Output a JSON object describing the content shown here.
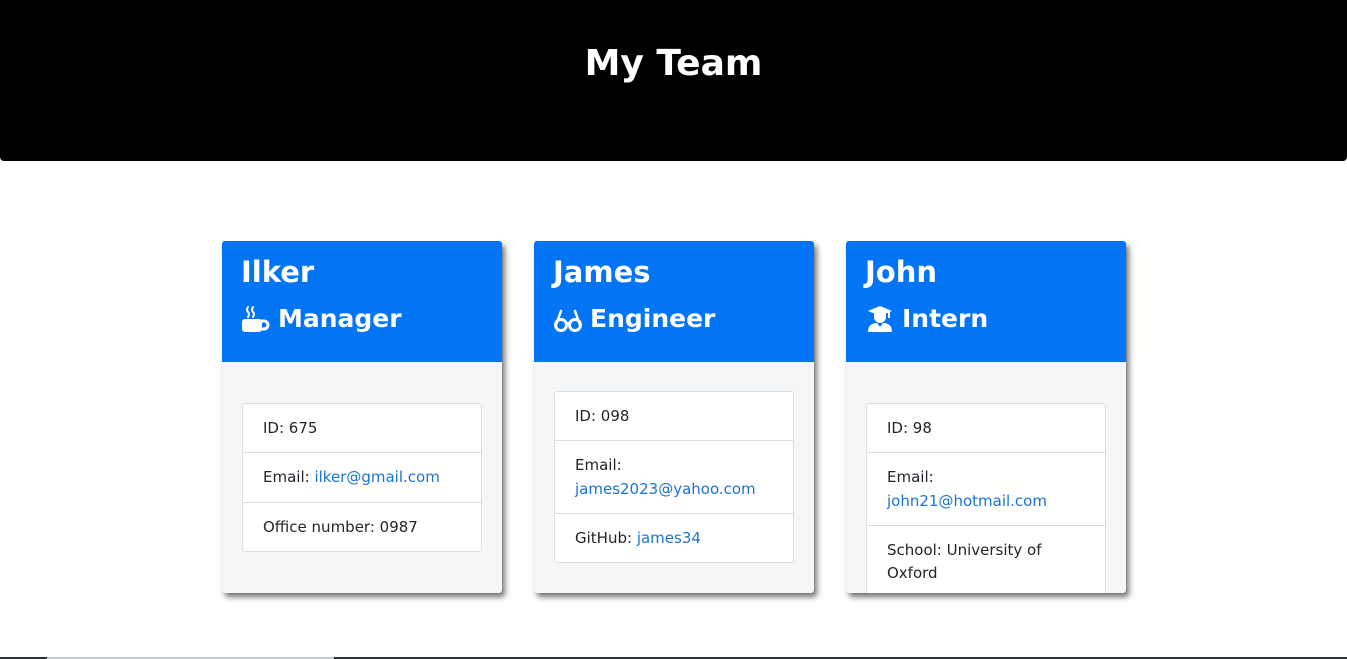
{
  "header": {
    "title": "My Team"
  },
  "team": [
    {
      "name": "Ilker",
      "role": "Manager",
      "icon": "coffee-mug-icon",
      "id_label": "ID: ",
      "id": "675",
      "email_label": "Email: ",
      "email": "ilker@gmail.com",
      "extra_label": "Office number: ",
      "extra": "0987"
    },
    {
      "name": "James",
      "role": "Engineer",
      "icon": "glasses-icon",
      "id_label": "ID: ",
      "id": "098",
      "email_label": "Email: ",
      "email": "james2023@yahoo.com",
      "extra_label": "GitHub: ",
      "extra": "james34"
    },
    {
      "name": "John",
      "role": "Intern",
      "icon": "graduate-icon",
      "id_label": "ID: ",
      "id": "98",
      "email_label": "Email: ",
      "email": "john21@hotmail.com",
      "extra_label": "School: ",
      "extra": "University of Oxford"
    }
  ],
  "colors": {
    "header_bg": "#000000",
    "card_header_bg": "#0275f7",
    "card_body_bg": "#f5f6f7",
    "link": "#1a73d1"
  }
}
